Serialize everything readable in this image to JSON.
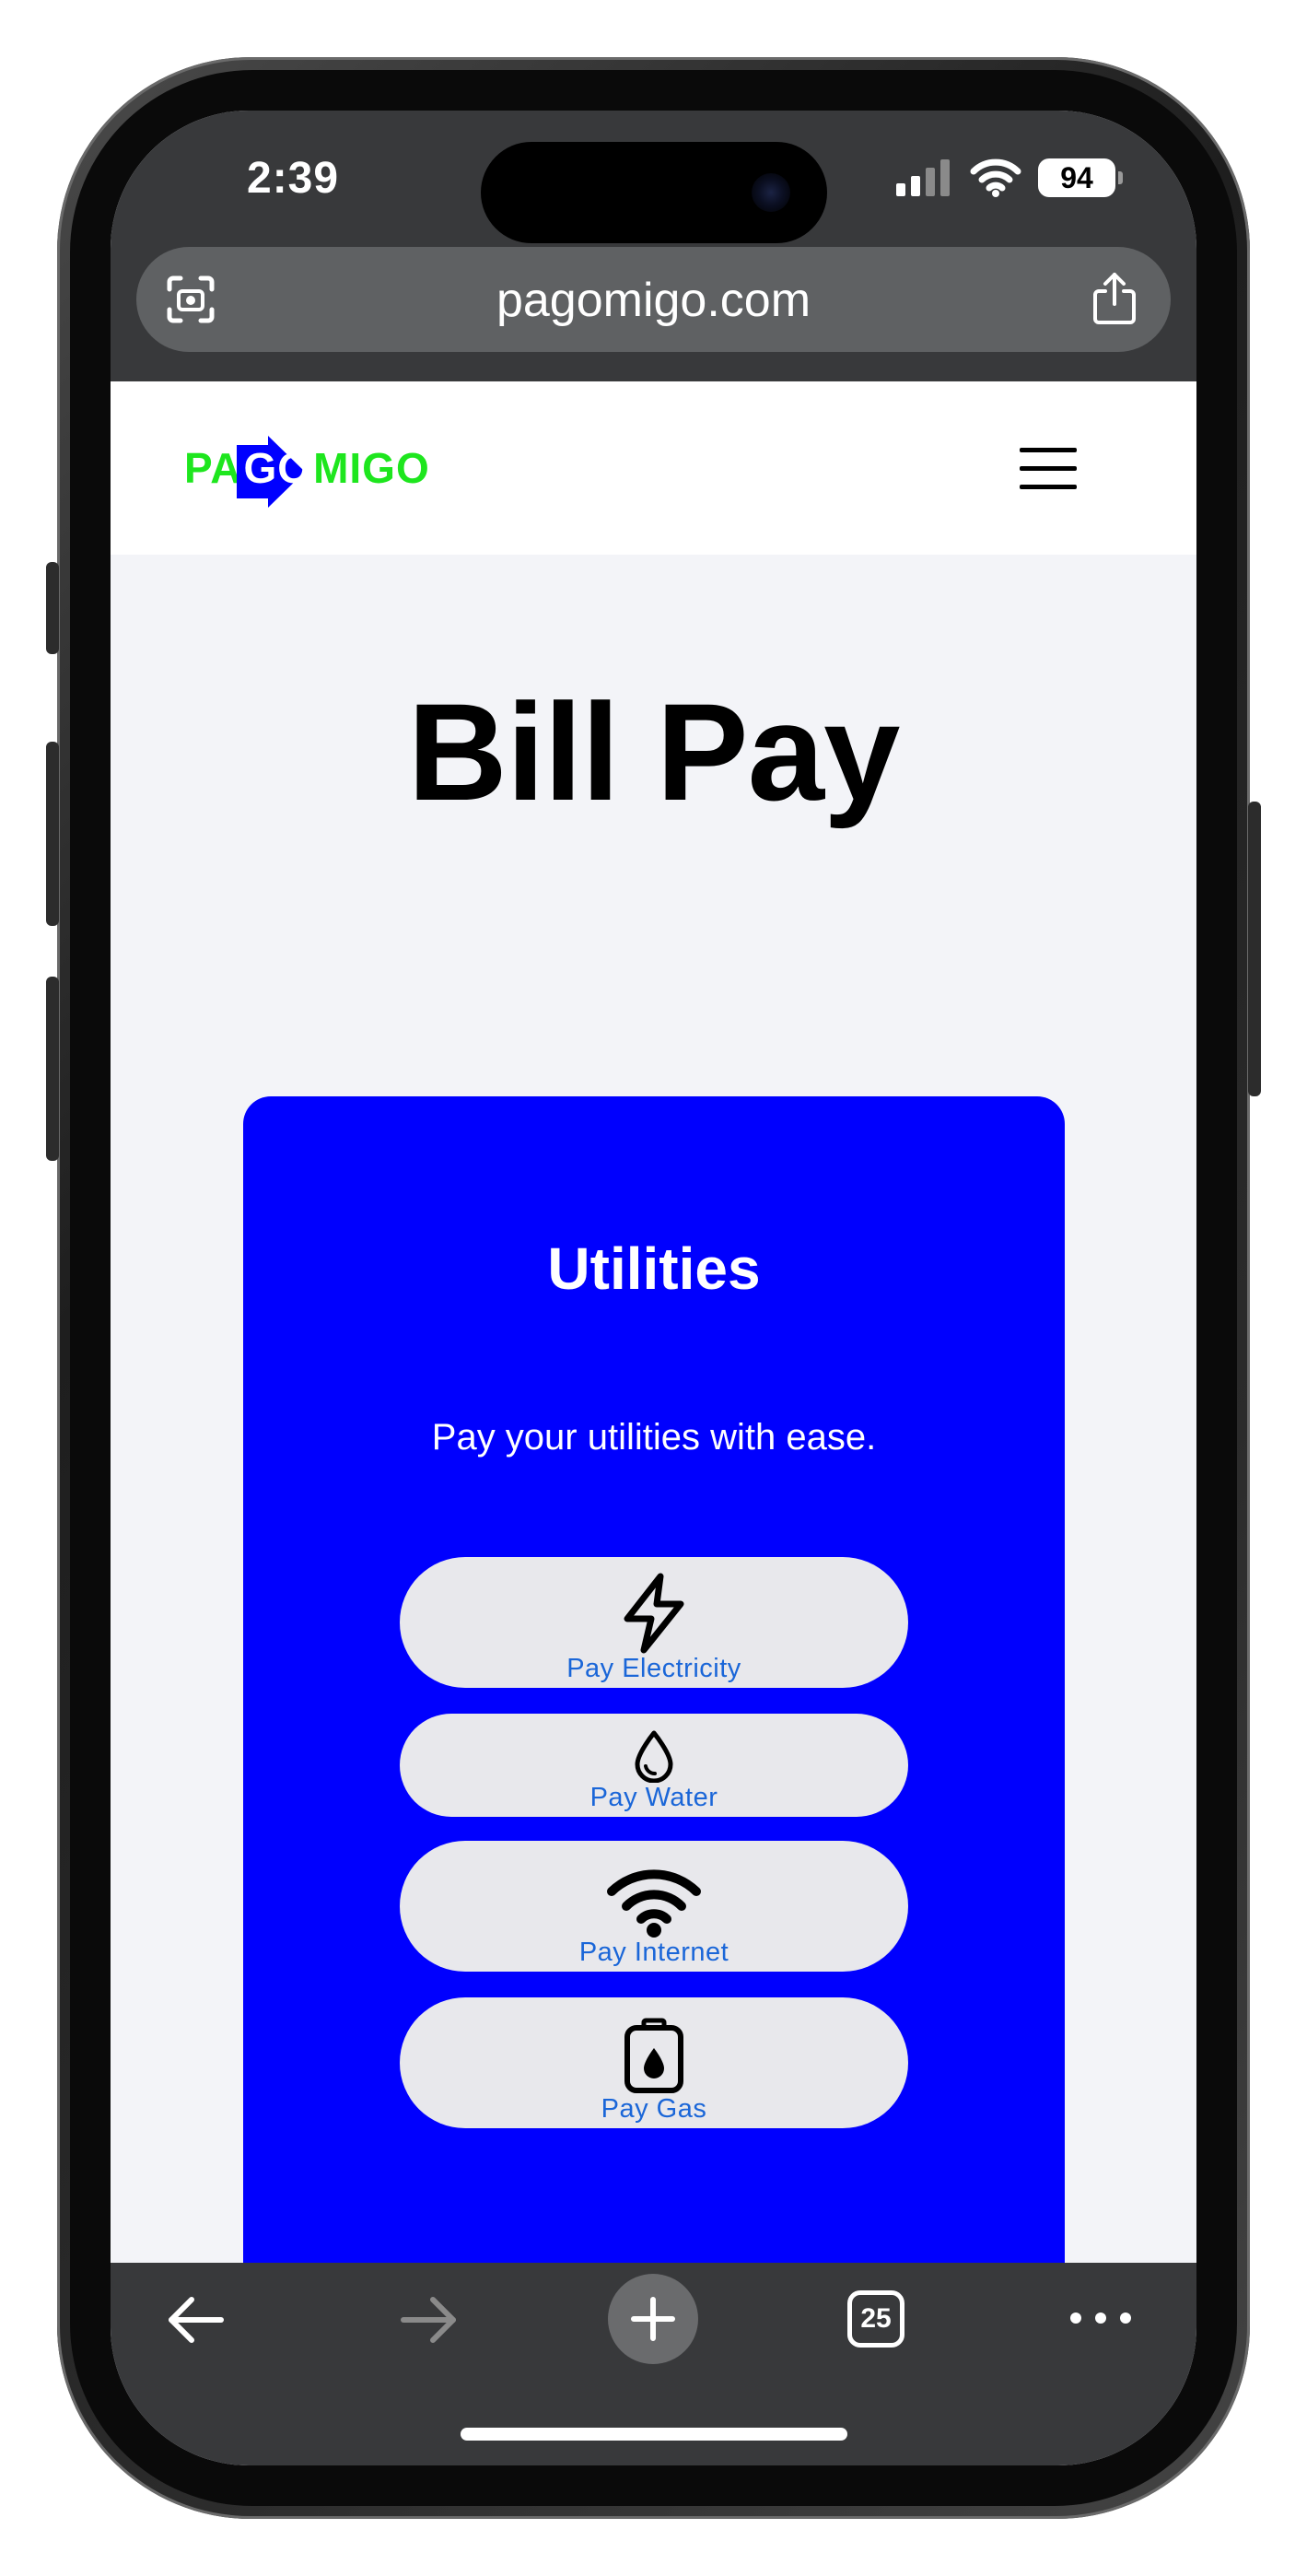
{
  "status_bar": {
    "time": "2:39",
    "battery": "94",
    "icons": [
      "signal-icon",
      "wifi-icon",
      "battery-icon"
    ]
  },
  "browser": {
    "url": "pagomigo.com",
    "left_icon": "camera-scan-icon",
    "right_icon": "share-icon",
    "toolbar": {
      "back_icon": "arrow-left-icon",
      "forward_icon": "arrow-right-icon",
      "new_tab_icon": "plus-icon",
      "tab_count": "25",
      "more_icon": "more-dots-icon"
    }
  },
  "site": {
    "logo": {
      "left": "PA",
      "middle": "GO",
      "right": "MIGO"
    },
    "menu_icon": "hamburger-menu-icon"
  },
  "page": {
    "title": "Bill Pay",
    "card": {
      "title": "Utilities",
      "subtitle": "Pay your utilities with ease.",
      "buttons": [
        {
          "label": "Pay Electricity",
          "icon": "lightning-icon"
        },
        {
          "label": "Pay Water",
          "icon": "water-drop-icon"
        },
        {
          "label": "Pay Internet",
          "icon": "wifi-icon"
        },
        {
          "label": "Pay Gas",
          "icon": "gas-canister-icon"
        }
      ]
    }
  },
  "colors": {
    "card_bg": "#0000fe",
    "logo_green": "#1ee61e",
    "logo_blue": "#0000ff",
    "button_text": "#1a66d8",
    "browser_chrome": "#38393b"
  }
}
